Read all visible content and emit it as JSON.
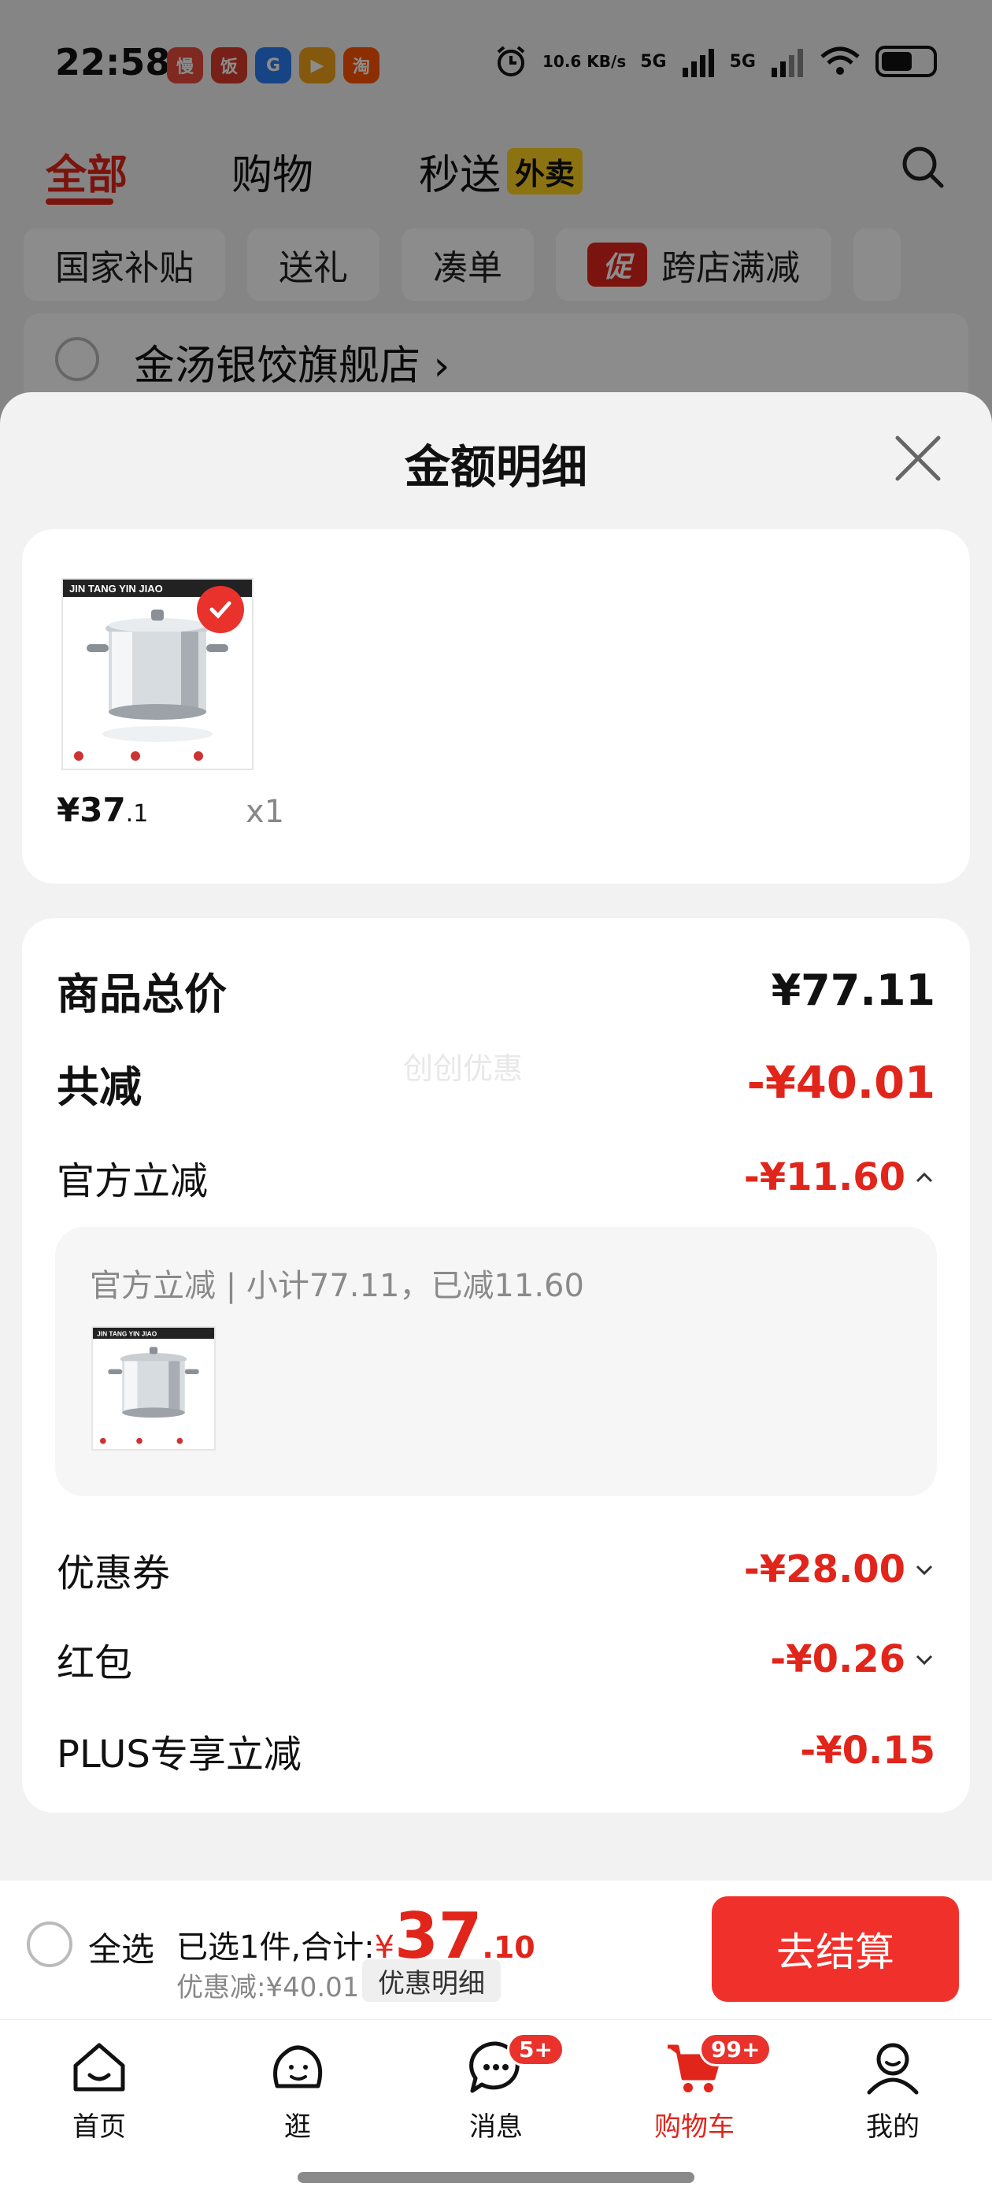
{
  "status_bar": {
    "time": "22:58",
    "app_icons": [
      {
        "icon": "manhua-app-icon",
        "text": "慢",
        "color": "#e94b3c"
      },
      {
        "icon": "xiaohongshu-app-icon",
        "text": "饭",
        "color": "#d93b2b"
      },
      {
        "icon": "swirl-app-icon",
        "text": "G",
        "color": "#2b7cf0"
      },
      {
        "icon": "video-app-icon",
        "text": "▶",
        "color": "#f0a31b"
      },
      {
        "icon": "taobao-app-icon",
        "text": "淘",
        "color": "#ff5500"
      }
    ],
    "net_speed": "10.6 KB/s",
    "signal_1": "5G",
    "signal_2": "5G"
  },
  "top_tabs": {
    "all": "全部",
    "shopping": "购物",
    "flash": "秒送",
    "flash_badge": "外卖"
  },
  "chips": [
    "国家补贴",
    "送礼",
    "凑单",
    "跨店满减"
  ],
  "chip_promo_mark": "促",
  "store": {
    "name": "金汤银饺旗舰店 ›"
  },
  "sheet": {
    "title": "金额明细",
    "product": {
      "price_int": "¥37",
      "price_dec": ".1",
      "qty": "x1"
    },
    "detail": {
      "total_label": "商品总价",
      "total_value": "¥77.11",
      "reduce_label": "共减",
      "reduce_value": "-¥40.01",
      "watermark": "创创优惠",
      "official_label": "官方立减",
      "official_value": "-¥11.60",
      "official_sub": "官方立减 | 小计77.11，已减11.60",
      "coupon_label": "优惠券",
      "coupon_value": "-¥28.00",
      "redpack_label": "红包",
      "redpack_value": "-¥0.26",
      "plus_label": "PLUS专享立减",
      "plus_value": "-¥0.15"
    }
  },
  "checkout": {
    "select_all": "全选",
    "summary_prefix": "已选1件,合计:",
    "currency": "¥",
    "total_int": "37",
    "total_dec": ".10",
    "discount_text": "优惠减:¥40.01",
    "detail_button": "优惠明细",
    "pay_button": "去结算"
  },
  "tabbar": {
    "items": [
      {
        "label": "首页",
        "icon": "home-icon"
      },
      {
        "label": "逛",
        "icon": "browse-icon"
      },
      {
        "label": "消息",
        "icon": "message-icon",
        "badge": "5+"
      },
      {
        "label": "购物车",
        "icon": "cart-icon",
        "badge": "99+"
      },
      {
        "label": "我的",
        "icon": "profile-icon"
      }
    ]
  },
  "colors": {
    "accent": "#e1251b",
    "pay_button": "#f0312b",
    "promo_badge": "#ffd21f"
  }
}
